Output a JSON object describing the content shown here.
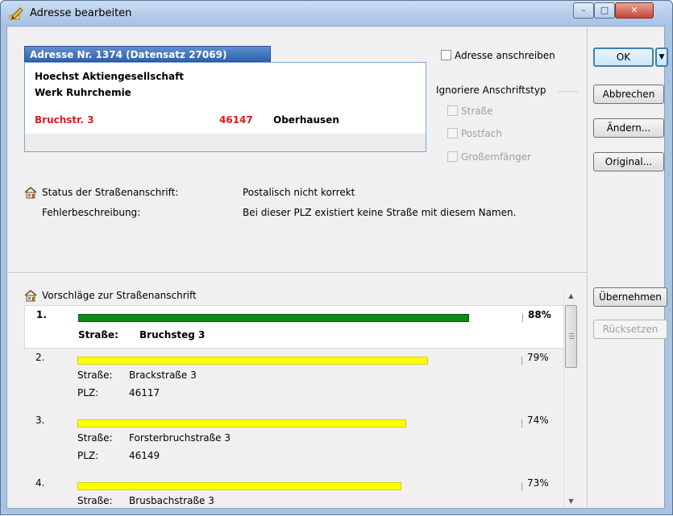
{
  "window": {
    "title": "Adresse bearbeiten",
    "minimize": "–",
    "maximize": "□",
    "close": "✕"
  },
  "address": {
    "tab_title": "Adresse Nr. 1374 (Datensatz 27069)",
    "line1": "Hoechst Aktiengesellschaft",
    "line2": "Werk Ruhrchemie",
    "street": "Bruchstr. 3",
    "zip": "46147",
    "city": "Oberhausen",
    "error_color": "#e01b1b"
  },
  "options": {
    "anschreiben_label": "Adresse anschreiben",
    "ignore_group_label": "Ignoriere Anschriftstyp",
    "strasse_label": "Straße",
    "postfach_label": "Postfach",
    "grossempfaenger_label": "Großemfänger"
  },
  "buttons": {
    "ok": "OK",
    "ok_arrow": "▼",
    "abbrechen": "Abbrechen",
    "aendern": "Ändern...",
    "original": "Original...",
    "uebernehmen": "Übernehmen",
    "ruecksetzen": "Rücksetzen"
  },
  "status": {
    "status_label": "Status der Straßenanschrift:",
    "status_value": "Postalisch nicht korrekt",
    "error_label": "Fehlerbeschreibung:",
    "error_value": "Bei dieser PLZ existiert keine Straße mit diesem Namen."
  },
  "suggestions": {
    "header": "Vorschläge zur Straßenanschrift",
    "items": [
      {
        "num": "1.",
        "percent_text": "88%",
        "percent": 88,
        "color": "green",
        "street_key": "Straße:",
        "street": "Bruchsteg 3",
        "plz_key": "",
        "plz": ""
      },
      {
        "num": "2.",
        "percent_text": "79%",
        "percent": 79,
        "color": "yellow",
        "street_key": "Straße:",
        "street": "Brackstraße 3",
        "plz_key": "PLZ:",
        "plz": "46117"
      },
      {
        "num": "3.",
        "percent_text": "74%",
        "percent": 74,
        "color": "yellow",
        "street_key": "Straße:",
        "street": "Forsterbruchstraße 3",
        "plz_key": "PLZ:",
        "plz": "46149"
      },
      {
        "num": "4.",
        "percent_text": "73%",
        "percent": 73,
        "color": "yellow",
        "street_key": "Straße:",
        "street": "Brusbachstraße 3",
        "plz_key": "",
        "plz": ""
      }
    ]
  },
  "scroll": {
    "up": "▲",
    "down": "▼"
  }
}
